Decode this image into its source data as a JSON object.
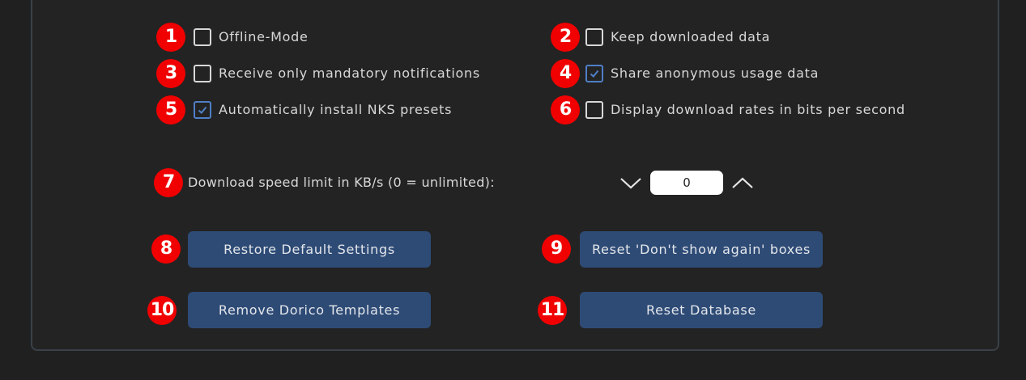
{
  "colors": {
    "background": "#202020",
    "panel_border": "#3a4148",
    "badge": "#f00000",
    "checkbox_checked": "#4f7fc7",
    "button": "#2e4b76"
  },
  "options": [
    {
      "badge": "1",
      "label": "Offline-Mode",
      "checked": false
    },
    {
      "badge": "2",
      "label": "Keep downloaded data",
      "checked": false
    },
    {
      "badge": "3",
      "label": "Receive only mandatory notifications",
      "checked": false
    },
    {
      "badge": "4",
      "label": "Share anonymous usage data",
      "checked": true
    },
    {
      "badge": "5",
      "label": "Automatically install NKS presets",
      "checked": true
    },
    {
      "badge": "6",
      "label": "Display download rates in bits per second",
      "checked": false
    }
  ],
  "speed_limit": {
    "badge": "7",
    "label": "Download speed limit in KB/s (0 = unlimited):",
    "value": "0",
    "decrease_icon": "chevron-down-icon",
    "increase_icon": "chevron-up-icon"
  },
  "buttons": [
    {
      "badge": "8",
      "label": "Restore Default Settings"
    },
    {
      "badge": "9",
      "label": "Reset 'Don't show again' boxes"
    },
    {
      "badge": "10",
      "label": "Remove Dorico Templates"
    },
    {
      "badge": "11",
      "label": "Reset Database"
    }
  ]
}
